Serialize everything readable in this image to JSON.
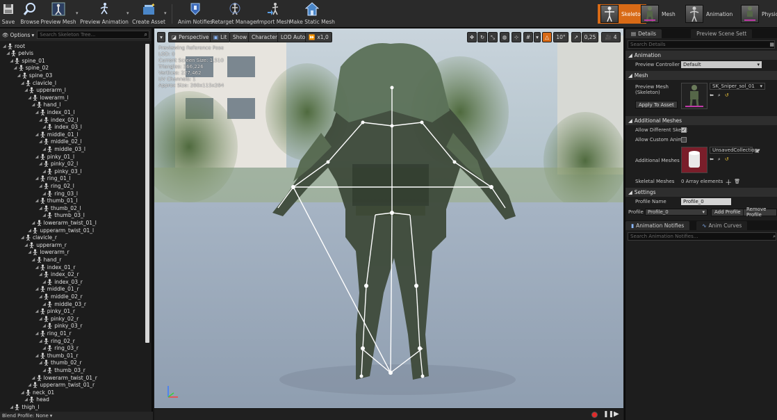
{
  "toolbar": {
    "save": "Save",
    "browse": "Browse",
    "preview_mesh": "Preview Mesh",
    "preview_animation": "Preview Animation",
    "create_asset": "Create Asset",
    "anim_notifies": "Anim Notifies",
    "retarget_manager": "Retarget Manager",
    "import_mesh": "Import Mesh",
    "make_static_mesh": "Make Static Mesh",
    "modes": [
      "Skeleton",
      "Mesh",
      "Animation",
      "Physics"
    ],
    "accent": "#d86a16"
  },
  "tree": {
    "options": "Options",
    "search_placeholder": "Search Skeleton Tree...",
    "bones": [
      {
        "label": "root",
        "depth": 0
      },
      {
        "label": "pelvis",
        "depth": 1
      },
      {
        "label": "spine_01",
        "depth": 2
      },
      {
        "label": "spine_02",
        "depth": 3
      },
      {
        "label": "spine_03",
        "depth": 4
      },
      {
        "label": "clavicle_l",
        "depth": 5
      },
      {
        "label": "upperarm_l",
        "depth": 6
      },
      {
        "label": "lowerarm_l",
        "depth": 7
      },
      {
        "label": "hand_l",
        "depth": 8
      },
      {
        "label": "index_01_l",
        "depth": 9
      },
      {
        "label": "index_02_l",
        "depth": 10
      },
      {
        "label": "index_03_l",
        "depth": 11
      },
      {
        "label": "middle_01_l",
        "depth": 9
      },
      {
        "label": "middle_02_l",
        "depth": 10
      },
      {
        "label": "middle_03_l",
        "depth": 11
      },
      {
        "label": "pinky_01_l",
        "depth": 9
      },
      {
        "label": "pinky_02_l",
        "depth": 10
      },
      {
        "label": "pinky_03_l",
        "depth": 11
      },
      {
        "label": "ring_01_l",
        "depth": 9
      },
      {
        "label": "ring_02_l",
        "depth": 10
      },
      {
        "label": "ring_03_l",
        "depth": 11
      },
      {
        "label": "thumb_01_l",
        "depth": 9
      },
      {
        "label": "thumb_02_l",
        "depth": 10
      },
      {
        "label": "thumb_03_l",
        "depth": 11
      },
      {
        "label": "lowerarm_twist_01_l",
        "depth": 8
      },
      {
        "label": "upperarm_twist_01_l",
        "depth": 7
      },
      {
        "label": "clavicle_r",
        "depth": 5
      },
      {
        "label": "upperarm_r",
        "depth": 6
      },
      {
        "label": "lowerarm_r",
        "depth": 7
      },
      {
        "label": "hand_r",
        "depth": 8
      },
      {
        "label": "index_01_r",
        "depth": 9
      },
      {
        "label": "index_02_r",
        "depth": 10
      },
      {
        "label": "index_03_r",
        "depth": 11
      },
      {
        "label": "middle_01_r",
        "depth": 9
      },
      {
        "label": "middle_02_r",
        "depth": 10
      },
      {
        "label": "middle_03_r",
        "depth": 11
      },
      {
        "label": "pinky_01_r",
        "depth": 9
      },
      {
        "label": "pinky_02_r",
        "depth": 10
      },
      {
        "label": "pinky_03_r",
        "depth": 11
      },
      {
        "label": "ring_01_r",
        "depth": 9
      },
      {
        "label": "ring_02_r",
        "depth": 10
      },
      {
        "label": "ring_03_r",
        "depth": 11
      },
      {
        "label": "thumb_01_r",
        "depth": 9
      },
      {
        "label": "thumb_02_r",
        "depth": 10
      },
      {
        "label": "thumb_03_r",
        "depth": 11
      },
      {
        "label": "lowerarm_twist_01_r",
        "depth": 8
      },
      {
        "label": "upperarm_twist_01_r",
        "depth": 7
      },
      {
        "label": "neck_01",
        "depth": 5
      },
      {
        "label": "head",
        "depth": 6
      },
      {
        "label": "thigh_l",
        "depth": 2
      }
    ],
    "footer": "Blend Profile: None"
  },
  "viewport": {
    "perspective": "Perspective",
    "lit": "Lit",
    "show": "Show",
    "character": "Character",
    "lod": "LOD Auto",
    "speed": "x1,0",
    "snap_angle": "10°",
    "snap_scale": "0,25",
    "camera_speed": "4",
    "info": [
      "Previewing Reference Pose",
      "LOD: 0",
      "Current Screen Size: 1,510",
      "Triangles: 366,226",
      "Vertices: 227,462",
      "UV Channels: 1",
      "Approx Size: 280x115x284"
    ]
  },
  "details": {
    "tab_details": "Details",
    "tab_preview": "Preview Scene Sett",
    "search_placeholder": "Search Details",
    "cat_animation": "Animation",
    "preview_controller_label": "Preview Controller",
    "preview_controller_value": "Default",
    "cat_mesh": "Mesh",
    "preview_mesh_label": "Preview Mesh (Skeleton)",
    "preview_mesh_value": "SK_Sniper_sol_01",
    "apply_to_asset": "Apply To Asset",
    "cat_additional": "Additional Meshes",
    "allow_diff_skel": "Allow Different Skelet",
    "allow_custom_anim": "Allow Custom AnimBl",
    "additional_meshes_label": "Additional Meshes",
    "additional_meshes_value": "UnsavedCollection",
    "skeletal_meshes_label": "Skeletal Meshes",
    "skeletal_meshes_value": "0 Array elements",
    "cat_settings": "Settings",
    "profile_name_label": "Profile Name",
    "profile_name_value": "Profile_0",
    "profile_label": "Profile",
    "profile_value": "Profile_0",
    "add_profile": "Add Profile",
    "remove_profile": "Remove Profile"
  },
  "notifies": {
    "tab_notifies": "Animation Notifies",
    "tab_curves": "Anim Curves",
    "search_placeholder": "Search Animation Notifies..."
  }
}
